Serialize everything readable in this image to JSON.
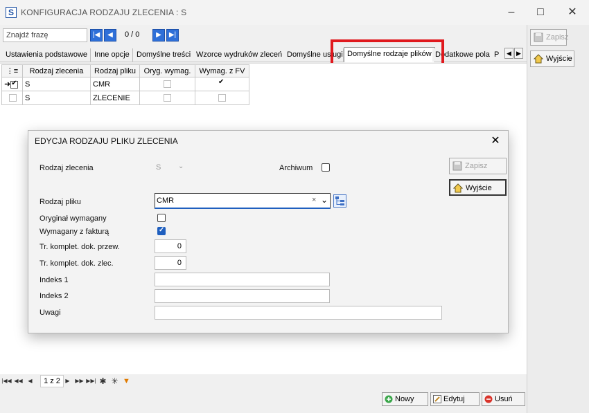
{
  "window": {
    "title": "KONFIGURACJA RODZAJU ZLECENIA : S",
    "app_icon": "S"
  },
  "toolbar": {
    "search_placeholder": "Znajdź frazę",
    "counter": "0 / 0"
  },
  "right_panel": {
    "save_label": "Zapisz",
    "exit_label": "Wyjście"
  },
  "tabs": [
    {
      "label": "Ustawienia podstawowe"
    },
    {
      "label": "Inne opcje"
    },
    {
      "label": "Domyślne treści"
    },
    {
      "label": "Wzorce wydruków zleceń"
    },
    {
      "label": "Domyślne usługi"
    },
    {
      "label": "Domyślne rodzaje plików"
    },
    {
      "label": "Dodatkowe pola"
    },
    {
      "label": "P"
    }
  ],
  "grid": {
    "columns": [
      "Rodzaj zlecenia",
      "Rodzaj pliku",
      "Oryg. wymag.",
      "Wymag. z FV"
    ],
    "rows": [
      {
        "rodzaj_zlecenia": "S",
        "rodzaj_pliku": "CMR",
        "oryg_wymag": false,
        "wymag_fv": true,
        "selected": true,
        "current": true
      },
      {
        "rodzaj_zlecenia": "S",
        "rodzaj_pliku": "ZLECENIE",
        "oryg_wymag": false,
        "wymag_fv": false,
        "selected": false,
        "current": false
      }
    ]
  },
  "bottom_nav": {
    "page": "1 z 2"
  },
  "bottom_buttons": {
    "new_label": "Nowy",
    "edit_label": "Edytuj",
    "delete_label": "Usuń"
  },
  "dialog": {
    "title": "EDYCJA RODZAJU PLIKU ZLECENIA",
    "save_label": "Zapisz",
    "exit_label": "Wyjście",
    "rodzaj_zlecenia_label": "Rodzaj zlecenia",
    "rodzaj_zlecenia_value": "S",
    "archiwum_label": "Archiwum",
    "archiwum_checked": false,
    "rodzaj_pliku_label": "Rodzaj pliku",
    "rodzaj_pliku_value": "CMR",
    "oryginal_label": "Oryginał wymagany",
    "oryginal_checked": false,
    "wymagany_fv_label": "Wymagany z fakturą",
    "wymagany_fv_checked": true,
    "tr_przew_label": "Tr. komplet. dok. przew.",
    "tr_przew_value": "0",
    "tr_zlec_label": "Tr. komplet. dok. zlec.",
    "tr_zlec_value": "0",
    "indeks1_label": "Indeks 1",
    "indeks1_value": "",
    "indeks2_label": "Indeks 2",
    "indeks2_value": "",
    "uwagi_label": "Uwagi",
    "uwagi_value": ""
  },
  "colors": {
    "accent": "#2e6fd8",
    "highlight": "#e0191e",
    "checkbox_on": "#1f5fbf"
  }
}
